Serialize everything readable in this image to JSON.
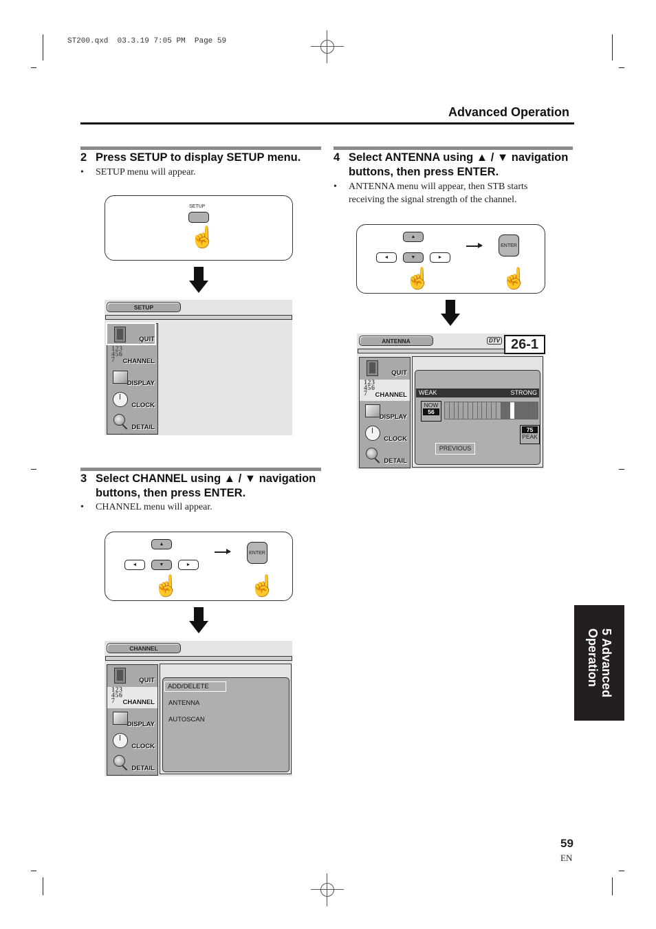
{
  "print_header": {
    "file": "ST200.qxd",
    "date": "03.3.19",
    "time": "7:05 PM",
    "page_label": "Page 59"
  },
  "section": {
    "title": "Advanced Operation"
  },
  "steps": [
    {
      "number": "2",
      "heading_line1": "Press SETUP to display SETUP menu.",
      "heading_line2": "",
      "bullets": [
        "SETUP menu will appear."
      ],
      "remote": {
        "button_label": "SETUP"
      },
      "screen": {
        "tab": "SETUP",
        "side_menu": [
          {
            "label": "QUIT",
            "icon": "door-icon",
            "selected": true
          },
          {
            "label": "CHANNEL",
            "icon": "numbers-icon",
            "selected": false
          },
          {
            "label": "DISPLAY",
            "icon": "tv-icon",
            "selected": false
          },
          {
            "label": "CLOCK",
            "icon": "clock-icon",
            "selected": false
          },
          {
            "label": "DETAIL",
            "icon": "magnifier-icon",
            "selected": false
          }
        ]
      }
    },
    {
      "number": "3",
      "heading_line1": "Select CHANNEL using ▲ / ▼ navigation",
      "heading_line2": "buttons, then press ENTER.",
      "bullets": [
        "CHANNEL menu will appear."
      ],
      "remote": {
        "up": "▲",
        "down": "▼",
        "left": "◄",
        "right": "►",
        "enter": "ENTER"
      },
      "screen": {
        "tab": "CHANNEL",
        "side_menu": [
          {
            "label": "QUIT",
            "icon": "door-icon",
            "selected": false
          },
          {
            "label": "CHANNEL",
            "icon": "numbers-icon",
            "selected": true
          },
          {
            "label": "DISPLAY",
            "icon": "tv-icon",
            "selected": false
          },
          {
            "label": "CLOCK",
            "icon": "clock-icon",
            "selected": false
          },
          {
            "label": "DETAIL",
            "icon": "magnifier-icon",
            "selected": false
          }
        ],
        "submenu": [
          {
            "label": "ADD/DELETE",
            "selected": true
          },
          {
            "label": "ANTENNA",
            "selected": false
          },
          {
            "label": "AUTOSCAN",
            "selected": false
          }
        ]
      }
    },
    {
      "number": "4",
      "heading_line1": "Select ANTENNA using ▲ / ▼ navigation",
      "heading_line2": "buttons, then press ENTER.",
      "bullets": [
        "ANTENNA menu will appear, then STB starts",
        "receiving the signal strength of the channel."
      ],
      "remote": {
        "up": "▲",
        "down": "▼",
        "left": "◄",
        "right": "►",
        "enter": "ENTER"
      },
      "screen": {
        "tab": "ANTENNA",
        "badge": "DTV",
        "channel": "26-1",
        "side_menu": [
          {
            "label": "QUIT",
            "icon": "door-icon",
            "selected": false
          },
          {
            "label": "CHANNEL",
            "icon": "numbers-icon",
            "selected": true
          },
          {
            "label": "DISPLAY",
            "icon": "tv-icon",
            "selected": false
          },
          {
            "label": "CLOCK",
            "icon": "clock-icon",
            "selected": false
          },
          {
            "label": "DETAIL",
            "icon": "magnifier-icon",
            "selected": false
          }
        ],
        "signal": {
          "weak_label": "WEAK",
          "strong_label": "STRONG",
          "now_label": "NOW",
          "now_value": "56",
          "peak_label": "PEAK",
          "peak_value": "75",
          "segments_total": 20,
          "segments_lit": 12,
          "peak_segment": 15
        },
        "previous_button": "PREVIOUS"
      }
    }
  ],
  "side_tab": {
    "line1": "5 Advanced",
    "line2": "Operation"
  },
  "footer": {
    "page_number": "59",
    "language": "EN"
  }
}
